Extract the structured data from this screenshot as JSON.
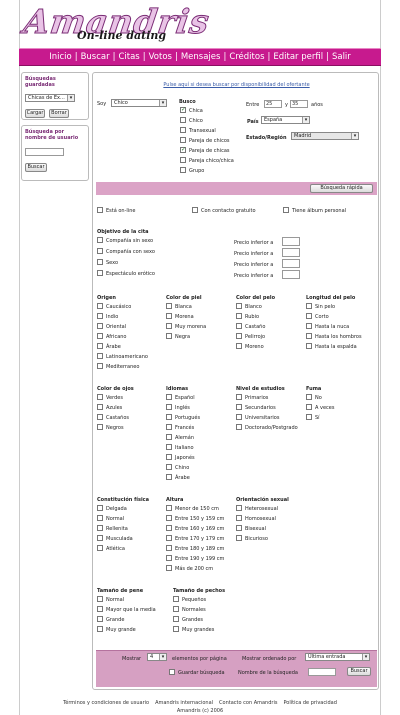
{
  "brand": {
    "name": "Amandris",
    "tagline": "On-line dating"
  },
  "nav": [
    "Inicio",
    "Buscar",
    "Citas",
    "Votos",
    "Mensajes",
    "Créditos",
    "Editar perfil",
    "Salir"
  ],
  "saved_searches": {
    "title": "Búsquedas guardadas",
    "selected": "Chicas de Ex...",
    "load": "Cargar",
    "delete": "Borrar"
  },
  "name_search": {
    "title": "Búsqueda por nombre de usuario",
    "value": "",
    "button": "Buscar"
  },
  "main": {
    "availability_link": "Pulse aquí si desea buscar por disponibilidad del ofertante",
    "soy_label": "Soy",
    "soy_value": "Chico",
    "busco_label": "Busco",
    "busco_options": [
      {
        "label": "Chica",
        "checked": true
      },
      {
        "label": "Chico",
        "checked": false
      },
      {
        "label": "Transexual",
        "checked": false
      },
      {
        "label": "Pareja de chicos",
        "checked": false
      },
      {
        "label": "Pareja de chicas",
        "checked": true
      },
      {
        "label": "Pareja chico/chica",
        "checked": false
      },
      {
        "label": "Grupo",
        "checked": false
      }
    ],
    "age": {
      "label_from": "Entre",
      "from": "25",
      "label_and": "y",
      "to": "35",
      "label_unit": "años"
    },
    "country_label": "País",
    "country_value": "España",
    "region_label": "Estado/Región",
    "region_value": "Madrid",
    "quick_search": "Búsqueda rápida",
    "flags": [
      {
        "label": "Está on-line",
        "checked": false
      },
      {
        "label": "Con contacto gratuito",
        "checked": false
      },
      {
        "label": "Tiene álbum personal",
        "checked": false
      }
    ],
    "objective": {
      "title": "Objetivo de la cita",
      "items": [
        {
          "label": "Compañía sin sexo",
          "price_label": "Precio inferior a",
          "price": ""
        },
        {
          "label": "Compañía con sexo",
          "price_label": "Precio inferior a",
          "price": ""
        },
        {
          "label": "Sexo",
          "price_label": "Precio inferior a",
          "price": ""
        },
        {
          "label": "Espectáculo erótico",
          "price_label": "Precio inferior a",
          "price": ""
        }
      ]
    },
    "groups_row1": [
      {
        "title": "Origen",
        "items": [
          "Caucásico",
          "Indio",
          "Oriental",
          "Africano",
          "Árabe",
          "Latinoamericano",
          "Mediterraneo"
        ]
      },
      {
        "title": "Color de piel",
        "items": [
          "Blanca",
          "Morena",
          "Muy morena",
          "Negra"
        ]
      },
      {
        "title": "Color del pelo",
        "items": [
          "Blanco",
          "Rubio",
          "Castaño",
          "Pelirrojo",
          "Moreno"
        ]
      },
      {
        "title": "Longitud del pelo",
        "items": [
          "Sin pelo",
          "Corto",
          "Hasta la nuca",
          "Hasta los hombros",
          "Hasta la espalda"
        ]
      }
    ],
    "groups_row2": [
      {
        "title": "Color de ojos",
        "items": [
          "Verdes",
          "Azules",
          "Castaños",
          "Negros"
        ]
      },
      {
        "title": "Idiomas",
        "items": [
          "Español",
          "Inglés",
          "Portugués",
          "Francés",
          "Alemán",
          "Italiano",
          "Japonés",
          "Chino",
          "Árabe"
        ]
      },
      {
        "title": "Nivel de estudios",
        "items": [
          "Primarios",
          "Secundarios",
          "Universitarios",
          "Doctorado/Postgrado"
        ]
      },
      {
        "title": "Fuma",
        "items": [
          "No",
          "A veces",
          "Sí"
        ]
      }
    ],
    "groups_row3": [
      {
        "title": "Constitución física",
        "items": [
          "Delgada",
          "Normal",
          "Rellenita",
          "Musculada",
          "Atlética"
        ]
      },
      {
        "title": "Altura",
        "items": [
          "Menor de 150 cm",
          "Entre 150 y 159 cm",
          "Entre 160 y 169 cm",
          "Entre 170 y 179 cm",
          "Entre 180 y 189 cm",
          "Entre 190 y 199 cm",
          "Más de 200 cm"
        ]
      },
      {
        "title": "Orientación sexual",
        "items": [
          "Heterosexual",
          "Homosexual",
          "Bisexual",
          "Bicurioso"
        ]
      }
    ],
    "groups_row4": [
      {
        "title": "Tamaño de pene",
        "items": [
          "Normal",
          "Mayor que la media",
          "Grande",
          "Muy grande"
        ]
      },
      {
        "title": "Tamaño de pechos",
        "items": [
          "Pequeños",
          "Normales",
          "Grandes",
          "Muy grandes"
        ]
      }
    ],
    "show_label": "Mostrar",
    "show_value": "4",
    "per_page_label": "elementos por página",
    "order_label": "Mostrar ordenado por",
    "order_value": "Última entrada",
    "save_label": "Guardar búsqueda",
    "search_name_label": "Nombre de la búsqueda",
    "search_name_value": "",
    "search_button": "Buscar"
  },
  "footer": {
    "links": [
      "Términos y condiciones de usuario",
      "Amandris internacional",
      "Contacto con Amandris",
      "Política de privacidad"
    ],
    "copyright": "Amandris (c) 2006"
  }
}
